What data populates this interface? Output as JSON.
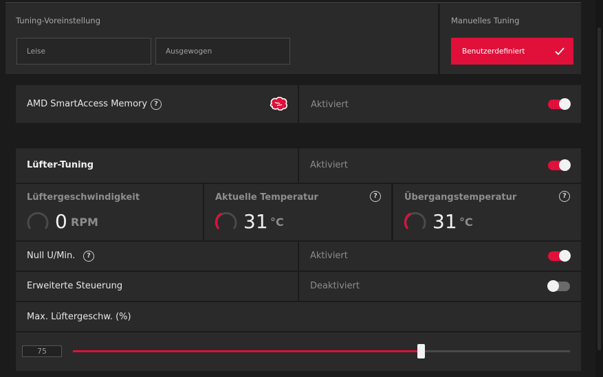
{
  "tuning": {
    "preset_label": "Tuning-Voreinstellung",
    "presets": [
      "Leise",
      "Ausgewogen"
    ],
    "manual_label": "Manuelles Tuning",
    "custom_button": "Benutzerdefiniert"
  },
  "smart_access": {
    "label": "AMD SmartAccess Memory",
    "status": "Aktiviert",
    "enabled": true
  },
  "fan_tuning": {
    "label": "Lüfter-Tuning",
    "status": "Aktiviert",
    "enabled": true
  },
  "metrics": {
    "fan_speed": {
      "label": "Lüftergeschwindigkeit",
      "value": "0",
      "unit": "RPM"
    },
    "current_temp": {
      "label": "Aktuelle Temperatur",
      "value": "31",
      "unit": "°C"
    },
    "junction_temp": {
      "label": "Übergangstemperatur",
      "value": "31",
      "unit": "°C"
    }
  },
  "zero_rpm": {
    "label": "Null U/Min.",
    "status": "Aktiviert",
    "enabled": true
  },
  "advanced_control": {
    "label": "Erweiterte Steuerung",
    "status": "Deaktiviert",
    "enabled": false
  },
  "max_fan": {
    "label": "Max. Lüftergeschw. (%)",
    "value": "75",
    "percent": 0.7
  },
  "colors": {
    "accent": "#e0103a",
    "panel": "#2a2a2a",
    "background": "#1b1b1b"
  }
}
